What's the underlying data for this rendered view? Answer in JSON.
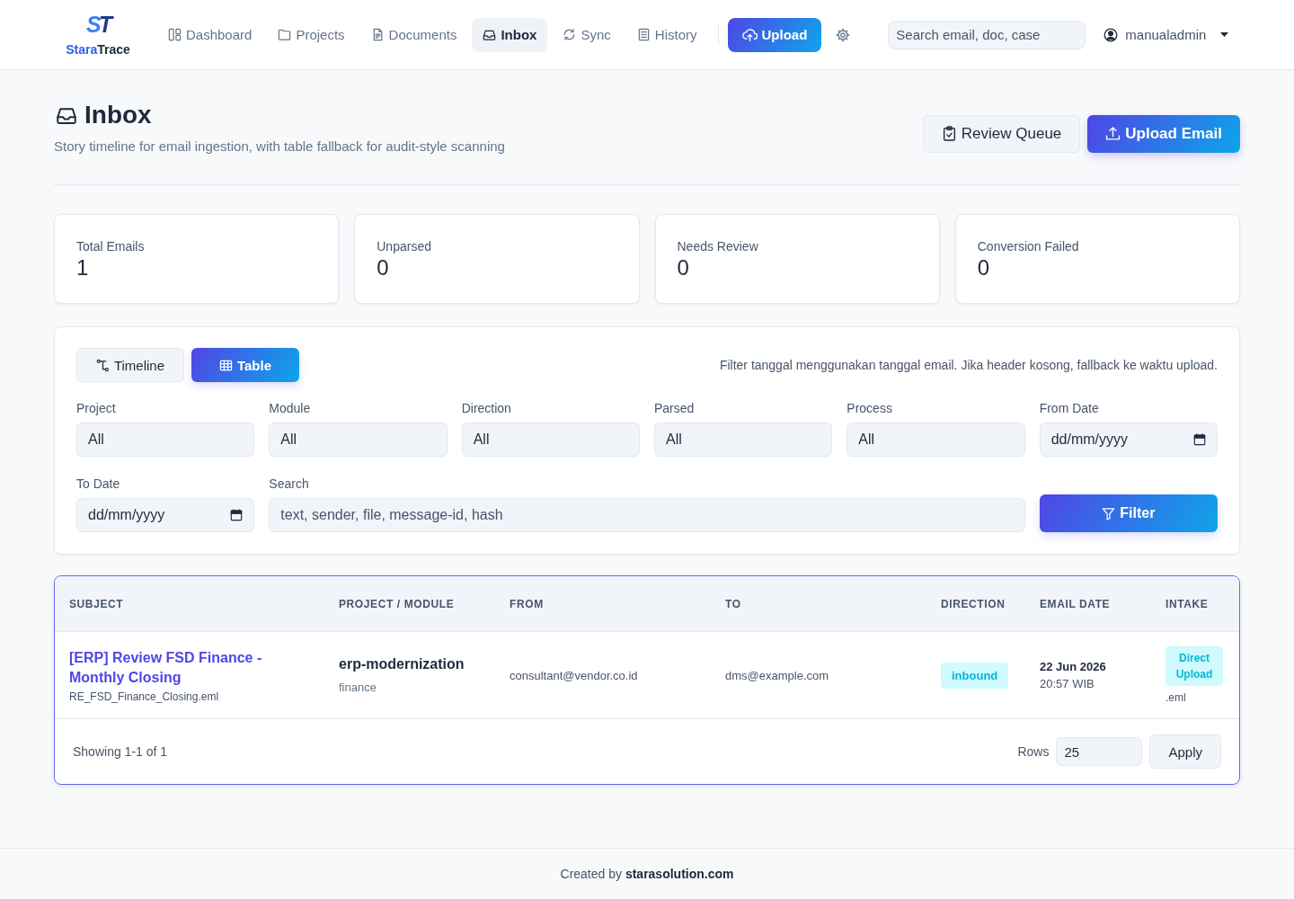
{
  "navbar": {
    "logo_mark": "ST",
    "brand": {
      "accent": "Stara",
      "rest": "Trace"
    },
    "nav_items": [
      {
        "label": "Dashboard",
        "selected": false
      },
      {
        "label": "Projects",
        "selected": false
      },
      {
        "label": "Documents",
        "selected": false
      },
      {
        "label": "Inbox",
        "selected": true
      },
      {
        "label": "Sync",
        "selected": false
      },
      {
        "label": "History",
        "selected": false
      }
    ],
    "upload_button": "Upload",
    "search": {
      "placeholder": "Search email, doc, case"
    },
    "user": {
      "name": "manualadmin"
    }
  },
  "page_header": {
    "title": "Inbox",
    "subtitle": "Story timeline for email ingestion, with table fallback for audit-style scanning",
    "buttons": [
      {
        "label": "Review Queue",
        "kind": "secondary"
      },
      {
        "label": "Upload Email",
        "kind": "primary"
      }
    ]
  },
  "stats": [
    {
      "label": "Total Emails",
      "value": "1"
    },
    {
      "label": "Unparsed",
      "value": "0"
    },
    {
      "label": "Needs Review",
      "value": "0"
    },
    {
      "label": "Conversion Failed",
      "value": "0"
    }
  ],
  "filter_panel": {
    "views": [
      {
        "label": "Timeline",
        "selected": false
      },
      {
        "label": "Table",
        "selected": true
      }
    ],
    "note": "Filter tanggal menggunakan tanggal email. Jika header kosong, fallback ke waktu upload.",
    "filters": [
      {
        "label": "Project",
        "kind": "select",
        "value": "All"
      },
      {
        "label": "Module",
        "kind": "select",
        "value": "All"
      },
      {
        "label": "Direction",
        "kind": "select",
        "value": "All"
      },
      {
        "label": "Parsed",
        "kind": "select",
        "value": "All"
      },
      {
        "label": "Process",
        "kind": "select",
        "value": "All"
      },
      {
        "label": "From Date",
        "kind": "date",
        "placeholder": "dd/mm/yyyy"
      },
      {
        "label": "To Date",
        "kind": "date",
        "placeholder": "dd/mm/yyyy"
      },
      {
        "label": "Search",
        "kind": "text",
        "placeholder": "text, sender, file, message-id, hash"
      }
    ],
    "filter_button": "Filter"
  },
  "table": {
    "columns": [
      "SUBJECT",
      "PROJECT / MODULE",
      "FROM",
      "TO",
      "DIRECTION",
      "EMAIL DATE",
      "INTAKE"
    ],
    "rows": [
      {
        "subject": "[ERP] Review FSD Finance - Monthly Closing",
        "file": "RE_FSD_Finance_Closing.eml",
        "project": "erp-modernization",
        "module": "finance",
        "from": "consultant@vendor.co.id",
        "to": "dms@example.com",
        "direction": "inbound",
        "date": "22 Jun 2026",
        "time": "20:57 WIB",
        "intake": "Direct Upload",
        "intake_file_type": ".eml"
      }
    ],
    "footer": {
      "summary": "Showing 1-1 of 1",
      "rows_label": "Rows",
      "rows_value": "25",
      "apply_button": "Apply"
    }
  },
  "footer": {
    "credit": "Created by **starasolution.com**"
  }
}
